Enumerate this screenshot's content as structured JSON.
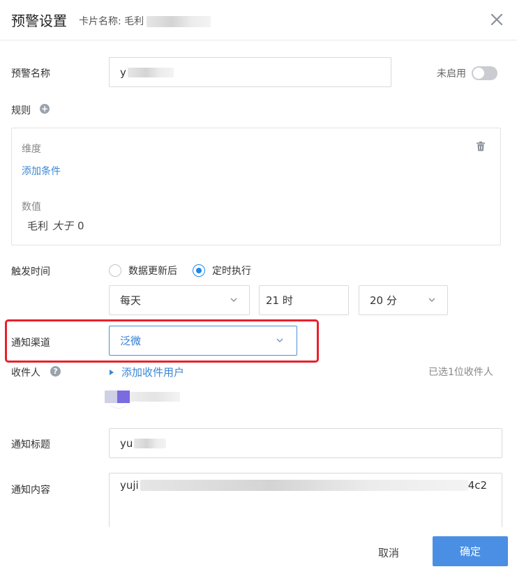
{
  "header": {
    "title": "预警设置",
    "card_name_label": "卡片名称: 毛利"
  },
  "form": {
    "alert_name": {
      "label": "预警名称",
      "value": "y"
    },
    "status": {
      "label": "未启用",
      "enabled": false
    },
    "rules": {
      "label": "规则",
      "dimension_label": "维度",
      "add_condition": "添加条件",
      "value_label": "数值",
      "expression": {
        "field": "毛利",
        "operator": "大于",
        "value": "0"
      }
    },
    "trigger": {
      "label": "触发时间",
      "options": [
        {
          "label": "数据更新后",
          "checked": false
        },
        {
          "label": "定时执行",
          "checked": true
        }
      ],
      "frequency": "每天",
      "hour": "21 时",
      "minute": "20 分"
    },
    "channel": {
      "label": "通知渠道",
      "value": "泛微"
    },
    "recipients": {
      "label": "收件人",
      "add_label": "添加收件用户",
      "selected_text": "已选1位收件人"
    },
    "notify_title": {
      "label": "通知标题",
      "value": "yu"
    },
    "notify_content": {
      "label": "通知内容",
      "prefix": "yuji",
      "suffix": "4c2"
    }
  },
  "footer": {
    "cancel": "取消",
    "confirm": "确定"
  },
  "colors": {
    "accent": "#3a86d6",
    "primary_button": "#4a8fe3",
    "highlight_border": "#e8212b"
  }
}
